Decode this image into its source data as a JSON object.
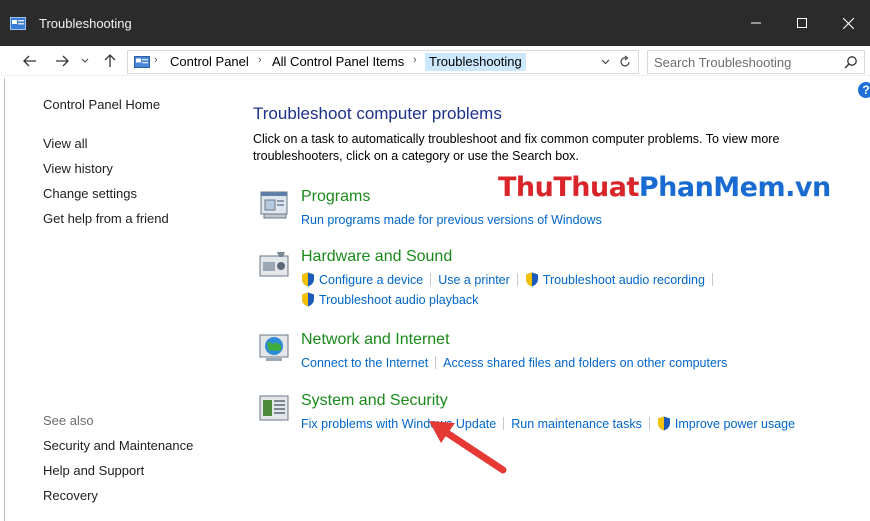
{
  "window": {
    "title": "Troubleshooting",
    "controls": {
      "minimize": "minimize-icon",
      "maximize": "maximize-icon",
      "close": "close-icon"
    }
  },
  "address": {
    "breadcrumbs": [
      "Control Panel",
      "All Control Panel Items",
      "Troubleshooting"
    ],
    "search_placeholder": "Search Troubleshooting"
  },
  "sidebar": {
    "home": "Control Panel Home",
    "items": [
      "View all",
      "View history",
      "Change settings",
      "Get help from a friend"
    ],
    "see_also_label": "See also",
    "see_also": [
      "Security and Maintenance",
      "Help and Support",
      "Recovery"
    ]
  },
  "main": {
    "title": "Troubleshoot computer problems",
    "description": "Click on a task to automatically troubleshoot and fix common computer problems. To view more troubleshooters, click on a category or use the Search box.",
    "categories": [
      {
        "name": "Programs",
        "icon": "programs-icon",
        "links": [
          "Run programs made for previous versions of Windows"
        ]
      },
      {
        "name": "Hardware and Sound",
        "icon": "hardware-sound-icon",
        "links": [
          "Configure a device",
          "Use a printer",
          "Troubleshoot audio recording",
          "Troubleshoot audio playback"
        ]
      },
      {
        "name": "Network and Internet",
        "icon": "network-internet-icon",
        "links": [
          "Connect to the Internet",
          "Access shared files and folders on other computers"
        ]
      },
      {
        "name": "System and Security",
        "icon": "system-security-icon",
        "links": [
          "Fix problems with Windows Update",
          "Run maintenance tasks",
          "Improve power usage"
        ]
      }
    ]
  },
  "watermark": {
    "part1": "ThuThuat",
    "part2": "PhanMem",
    "part3": ".vn"
  },
  "colors": {
    "titlebar": "#2b2b2b",
    "link": "#0066cc",
    "category": "#1a8a1a",
    "heading": "#1e3287",
    "annotation_arrow": "#e53935"
  }
}
